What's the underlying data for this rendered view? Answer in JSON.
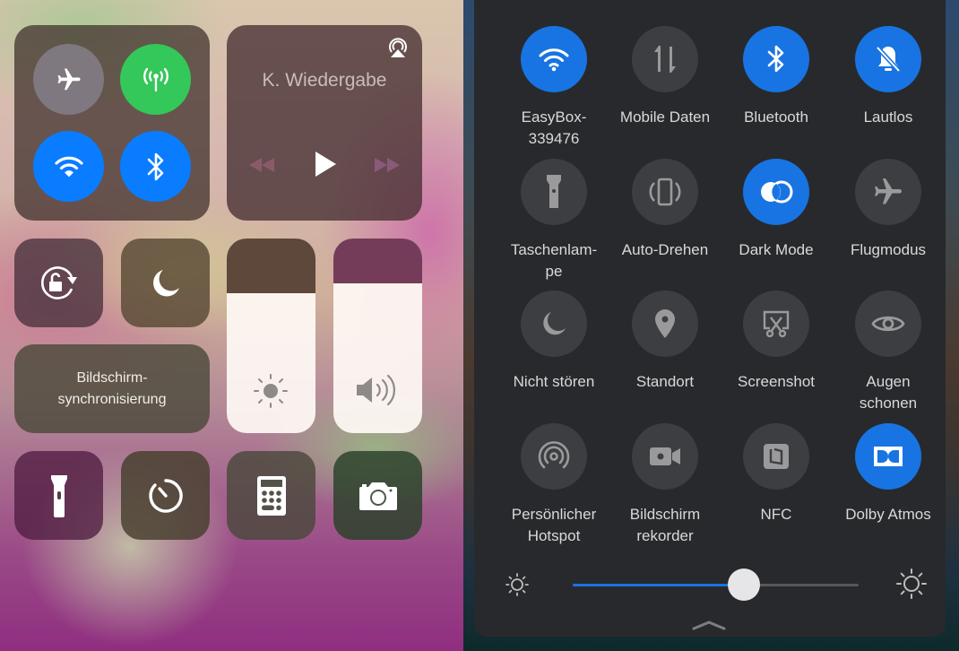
{
  "ios_control_center": {
    "connectivity": {
      "airplane": {
        "icon": "airplane-icon",
        "state": "off",
        "color": "#8a8690"
      },
      "cellular": {
        "icon": "cellular-antenna-icon",
        "state": "on",
        "color": "#34c759"
      },
      "wifi": {
        "icon": "wifi-icon",
        "state": "on",
        "color": "#0a7cff"
      },
      "bluetooth": {
        "icon": "bluetooth-icon",
        "state": "on",
        "color": "#0a7cff"
      }
    },
    "now_playing": {
      "title": "K. Wiedergabe",
      "airplay_icon": "airplay-icon",
      "controls": [
        "rewind",
        "play",
        "fast-forward"
      ]
    },
    "orientation_lock": {
      "icon": "rotation-lock-icon"
    },
    "do_not_disturb": {
      "icon": "moon-icon"
    },
    "screen_mirroring": {
      "label_line1": "Bildschirm-",
      "label_line2": "synchronisierung"
    },
    "brightness": {
      "icon": "sun-icon",
      "level": 0.72
    },
    "volume": {
      "icon": "speaker-icon",
      "level": 0.77
    },
    "shortcuts": [
      {
        "icon": "flashlight-icon"
      },
      {
        "icon": "timer-icon"
      },
      {
        "icon": "calculator-icon"
      },
      {
        "icon": "camera-icon"
      }
    ]
  },
  "android_quick_settings": {
    "accent": "#1874e2",
    "tiles": [
      {
        "label": "EasyBox-\n339476",
        "icon": "wifi-icon",
        "on": true
      },
      {
        "label": "Mobile Daten",
        "icon": "mobile-data-icon",
        "on": false
      },
      {
        "label": "Bluetooth",
        "icon": "bluetooth-icon",
        "on": true
      },
      {
        "label": "Lautlos",
        "icon": "bell-off-icon",
        "on": true
      },
      {
        "label": "Taschenlam-\npe",
        "icon": "flashlight-icon",
        "on": false
      },
      {
        "label": "Auto-Drehen",
        "icon": "auto-rotate-icon",
        "on": false
      },
      {
        "label": "Dark Mode",
        "icon": "dark-mode-icon",
        "on": true
      },
      {
        "label": "Flugmodus",
        "icon": "airplane-icon",
        "on": false
      },
      {
        "label": "Nicht stören",
        "icon": "moon-icon",
        "on": false
      },
      {
        "label": "Standort",
        "icon": "location-pin-icon",
        "on": false
      },
      {
        "label": "Screenshot",
        "icon": "screenshot-icon",
        "on": false
      },
      {
        "label": "Augen\nschonen",
        "icon": "eye-icon",
        "on": false
      },
      {
        "label": "Persönlicher\nHotspot",
        "icon": "hotspot-icon",
        "on": false
      },
      {
        "label": "Bildschirm\nrekorder",
        "icon": "screen-recorder-icon",
        "on": false
      },
      {
        "label": "NFC",
        "icon": "nfc-icon",
        "on": false
      },
      {
        "label": "Dolby Atmos",
        "icon": "dolby-icon",
        "on": true
      }
    ],
    "brightness": {
      "value": 0.6,
      "min_icon": "sun-small-icon",
      "max_icon": "sun-large-icon"
    },
    "collapse_icon": "chevron-up-icon"
  }
}
